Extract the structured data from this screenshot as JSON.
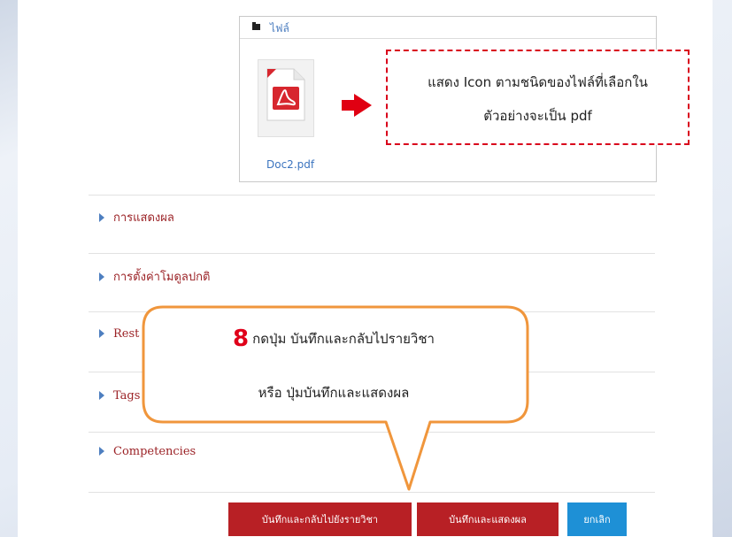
{
  "files": {
    "header_label": "ไฟล์",
    "file_name": "Doc2.pdf",
    "file_icon": "pdf-icon"
  },
  "annotation": {
    "line1": "แสดง Icon ตามชนิดของไฟล์ที่เลือกใน",
    "line2": "ตัวอย่างจะเป็น pdf",
    "border_color": "#d9001b"
  },
  "sections": [
    {
      "label": "การแสดงผล"
    },
    {
      "label": "การตั้งค่าโมดูลปกติ"
    },
    {
      "label": "Rest"
    },
    {
      "label": "Tags"
    },
    {
      "label": "Competencies"
    }
  ],
  "callout": {
    "number": "8",
    "line1": "กดปุ่ม บันทึกและกลับไปรายวิชา",
    "line2": "หรือ ปุ่มบันทึกและแสดงผล",
    "border_color": "#f0963c"
  },
  "buttons": {
    "save_return": "บันทึกและกลับไปยังรายวิชา",
    "save_display": "บันทึกและแสดงผล",
    "cancel": "ยกเลิก"
  },
  "colors": {
    "primary_button": "#b82025",
    "cancel_button": "#1e90d6",
    "section_text": "#9b2226",
    "link": "#3b74bf"
  }
}
